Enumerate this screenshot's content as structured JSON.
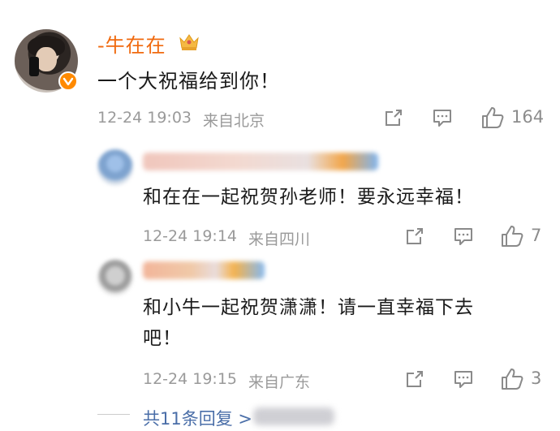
{
  "comment": {
    "username": "-牛在在",
    "text": "一个大祝福给到你！",
    "timestamp": "12-24 19:03",
    "location": "来自北京",
    "likes": "164",
    "icons": [
      "share-icon",
      "comment-icon",
      "like-icon"
    ],
    "name_color": "#f06a0f"
  },
  "replies": [
    {
      "text": "和在在一起祝贺孙老师！要永远幸福！",
      "timestamp": "12-24 19:14",
      "location": "来自四川",
      "likes": "7"
    },
    {
      "text_line1": "和小牛一起祝贺潇潇！请一直幸福下去",
      "text_line2": "吧！",
      "timestamp": "12-24 19:15",
      "location": "来自广东",
      "likes": "3"
    }
  ],
  "more_replies": "共11条回复 >"
}
